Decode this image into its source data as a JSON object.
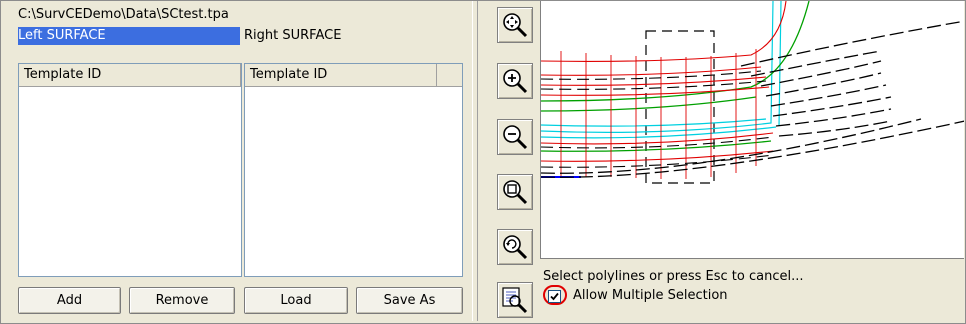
{
  "left": {
    "file_path": "C:\\SurvCEDemo\\Data\\SCtest.tpa",
    "left_surface_label": "Left SURFACE",
    "right_surface_label": "Right SURFACE",
    "left_list": {
      "column_header": "Template ID",
      "rows": []
    },
    "right_list": {
      "column_header": "Template ID",
      "rows": []
    },
    "buttons": {
      "add": "Add",
      "remove": "Remove",
      "load": "Load",
      "save_as": "Save As"
    }
  },
  "toolbar": {
    "tools": [
      {
        "icon": "zoom-extents-icon"
      },
      {
        "icon": "zoom-in-icon"
      },
      {
        "icon": "zoom-out-icon"
      },
      {
        "icon": "zoom-window-icon"
      },
      {
        "icon": "zoom-previous-icon"
      },
      {
        "icon": "select-icon"
      }
    ]
  },
  "canvas": {
    "prompt": "Select polylines or press Esc to cancel...",
    "allow_multiple_label": "Allow Multiple Selection",
    "allow_multiple_checked": true
  },
  "colors": {
    "selection": "#3c6ee0",
    "highlight_ring": "#e00000",
    "line_red": "#e00000",
    "line_green": "#00a000",
    "line_cyan": "#00d0e0",
    "line_blue": "#0000ff"
  }
}
